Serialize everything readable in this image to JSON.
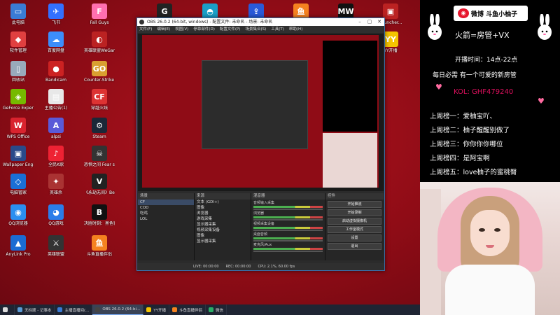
{
  "desktop_icons": [
    {
      "label": "此电脑",
      "color": "#3a7bd5",
      "glyph": "▭"
    },
    {
      "label": "软件管理",
      "color": "#e04040",
      "glyph": "◆"
    },
    {
      "label": "回收站",
      "color": "#9ab",
      "glyph": "▯"
    },
    {
      "label": "GeForce Experience",
      "color": "#76b900",
      "glyph": "◈"
    },
    {
      "label": "WPS Office",
      "color": "#d9232e",
      "glyph": "W"
    },
    {
      "label": "Wallpaper Engine：...",
      "color": "#2a4a8a",
      "glyph": "▣"
    },
    {
      "label": "电脑管家",
      "color": "#1a6fd6",
      "glyph": "◇"
    },
    {
      "label": "QQ浏览器",
      "color": "#2b8ff0",
      "glyph": "◉"
    },
    {
      "label": "AnyLink Pro",
      "color": "#1b6bd3",
      "glyph": "▲"
    },
    {
      "label": "飞书",
      "color": "#3370ff",
      "glyph": "✈"
    },
    {
      "label": "百度网盘",
      "color": "#3c8dfa",
      "glyph": "☁"
    },
    {
      "label": "Bandicam",
      "color": "#c22",
      "glyph": "●"
    },
    {
      "label": "主播公告(1)",
      "color": "#e8e8e8",
      "glyph": "▤"
    },
    {
      "label": "alpsi",
      "color": "#5a5ad8",
      "glyph": "A"
    },
    {
      "label": "全民K歌",
      "color": "#e23",
      "glyph": "♪"
    },
    {
      "label": "英雄杀",
      "color": "#a33",
      "glyph": "✦"
    },
    {
      "label": "QQ游戏",
      "color": "#2b7de9",
      "glyph": "◕"
    },
    {
      "label": "英雄联盟",
      "color": "#333",
      "glyph": "⚔"
    },
    {
      "label": "Fall Guys",
      "color": "#ff6fb0",
      "glyph": "F"
    },
    {
      "label": "英雄联盟WeGame版",
      "color": "#b22",
      "glyph": "◐"
    },
    {
      "label": "Counter-Strike Global Off...",
      "color": "#d9a030",
      "glyph": "GO"
    },
    {
      "label": "穿越火线",
      "color": "#d33",
      "glyph": "CF"
    },
    {
      "label": "Steam",
      "color": "#1b2838",
      "glyph": "⚙"
    },
    {
      "label": "恐惧之间 Fear sur...",
      "color": "#333",
      "glyph": "☠"
    },
    {
      "label": "《永劫无间》Beta",
      "color": "#222",
      "glyph": "V"
    },
    {
      "label": "决胜时刻：黑色行动冷战",
      "color": "#111",
      "glyph": "B"
    },
    {
      "label": "斗鱼直播伴侣",
      "color": "#f58220",
      "glyph": "鱼"
    },
    {
      "label": "",
      "color": "#222",
      "glyph": "G"
    },
    {
      "label": "",
      "color": "#1aa0c8",
      "glyph": "◓"
    },
    {
      "label": "",
      "color": "#2a5ad8",
      "glyph": "⇪"
    },
    {
      "label": "",
      "color": "#f58220",
      "glyph": "鱼"
    },
    {
      "label": "",
      "color": "#111",
      "glyph": "MW"
    },
    {
      "label": "Launcher...",
      "color": "#b22",
      "glyph": "▣"
    },
    {
      "label": "YY开播",
      "color": "#f5c400",
      "glyph": "YY"
    }
  ],
  "obs": {
    "title": "OBS 26.0.2 (64-bit, windows) - 配置文件: 未命名 - 场景: 未命名",
    "menu": [
      "文件(F)",
      "编辑(E)",
      "视图(V)",
      "停靠部件(D)",
      "配置文件(P)",
      "场景集合(S)",
      "工具(T)",
      "帮助(H)"
    ],
    "winbtns": [
      "–",
      "▢",
      "✕"
    ],
    "docks": {
      "scenes_title": "场景",
      "scenes": [
        "CF",
        "COD",
        "吃鸡",
        "LOL"
      ],
      "sources_title": "来源",
      "sources": [
        "文本 (GDI+)",
        "图像",
        "浏览器",
        "游戏采集",
        "显示器采集",
        "视频采集设备",
        "图像",
        "显示器采集"
      ],
      "mixer_title": "混音器",
      "mixer": [
        "音频输入采集",
        "浏览器",
        "视频采集设备",
        "桌面音频",
        "麦克风/Aux"
      ],
      "transition_title": "转场特效",
      "controls_title": "控件",
      "controls": [
        "开始推流",
        "开始录制",
        "启动虚拟摄像机",
        "工作室模式",
        "设置",
        "退出"
      ]
    },
    "status": [
      "LIVE: 00:00:00",
      "REC: 00:00:00",
      "CPU: 2.1%, 60.00 fps"
    ]
  },
  "taskbar": {
    "items": [
      {
        "label": "",
        "color": "#ddd"
      },
      {
        "label": "无标题 - 记事本",
        "color": "#5b9bd5"
      },
      {
        "label": "主播直播间(...",
        "color": "#3a7bd5"
      },
      {
        "label": "OBS 26.0.2 (64-bi...",
        "color": "#444"
      },
      {
        "label": "YY开播",
        "color": "#f5c400"
      },
      {
        "label": "斗鱼直播伴侣",
        "color": "#f58220"
      },
      {
        "label": "微信",
        "color": "#2aae67"
      }
    ]
  },
  "right_panel": {
    "weibo": "微博 斗鱼小柚子",
    "handle": "火箭=房管+VX",
    "hours": "开播时间：14点-22点",
    "slogan": "每日必需 有一个可爱的新房管",
    "kol": "KOL: GHF479240",
    "ranks": [
      "上周榜一：爱柚宝吖、",
      "上周榜二：柚子醒醒别做了",
      "上周榜三：你你你你哪位",
      "上周榜四：是阿宝啊",
      "上周榜五：love柚子的蜜桃臀"
    ]
  }
}
